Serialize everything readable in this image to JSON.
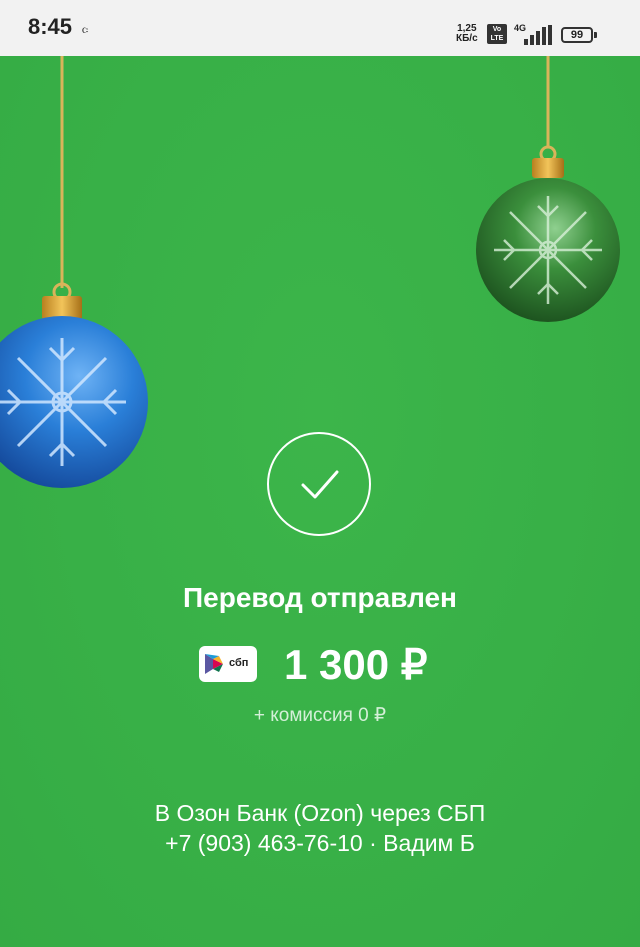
{
  "status_bar": {
    "time": "8:45",
    "notification_icon": "ꮸ",
    "net_speed_value": "1,25",
    "net_speed_unit": "КБ/с",
    "volte_top": "Vo",
    "volte_bottom": "LTE",
    "network": "4G",
    "battery": "99"
  },
  "transfer": {
    "title": "Перевод отправлен",
    "sbp_label": "сбп",
    "amount": "1 300 ₽",
    "commission": "+ комиссия 0 ₽",
    "recipient_bank": "В Озон Банк (Ozon) через СБП",
    "recipient_details": "+7 (903) 463-76-10 · Вадим Б"
  },
  "icons": {
    "success": "checkmark-icon",
    "sbp": "sbp-logo-icon"
  },
  "colors": {
    "background": "#3cb54a",
    "text": "#ffffff",
    "ornament_blue": "#1f6fd1",
    "ornament_green": "#2e7d32"
  }
}
